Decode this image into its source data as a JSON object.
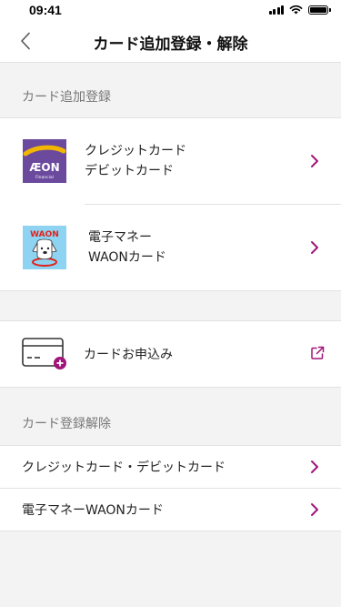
{
  "status": {
    "time": "09:41"
  },
  "header": {
    "title": "カード追加登録・解除"
  },
  "add_section": {
    "title": "カード追加登録",
    "items": [
      {
        "line1": "クレジットカード",
        "line2": "デビットカード",
        "logo_text": "ÆON",
        "logo_sub": "Financial"
      },
      {
        "line1": "電子マネー",
        "line2": "WAONカード",
        "logo_text": "WAON"
      }
    ]
  },
  "apply": {
    "label": "カードお申込み"
  },
  "remove_section": {
    "title": "カード登録解除",
    "items": [
      {
        "label": "クレジットカード・デビットカード"
      },
      {
        "label": "電子マネーWAONカード"
      }
    ]
  },
  "colors": {
    "accent": "#a1157a",
    "aeon_purple": "#6b4a9e",
    "aeon_gold": "#f2b600",
    "waon_blue": "#8ed3f2"
  }
}
